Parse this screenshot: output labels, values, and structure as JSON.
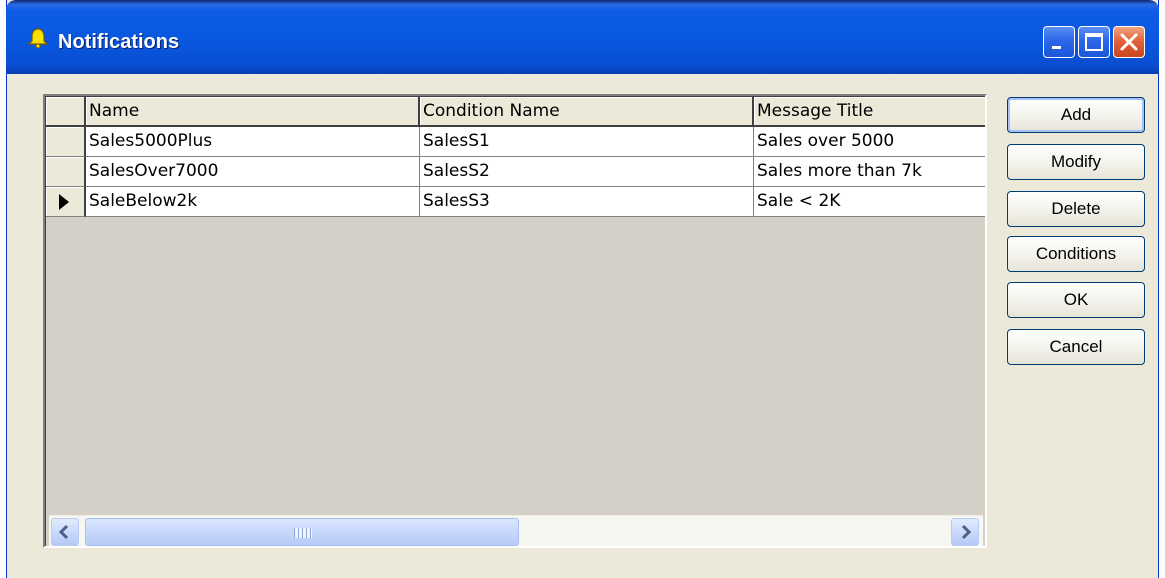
{
  "window": {
    "title": "Notifications",
    "icon": "bell-icon",
    "controls": [
      "minimize-icon",
      "maximize-icon",
      "close-icon"
    ]
  },
  "grid": {
    "columns": [
      "Name",
      "Condition Name",
      "Message Title"
    ],
    "rows": [
      {
        "name": "Sales5000Plus",
        "condition": "SalesS1",
        "title": "Sales over 5000",
        "current": false
      },
      {
        "name": "SalesOver7000",
        "condition": "SalesS2",
        "title": "Sales more than 7k",
        "current": false
      },
      {
        "name": "SaleBelow2k",
        "condition": "SalesS3",
        "title": "Sale < 2K",
        "current": true
      }
    ]
  },
  "buttons": {
    "add": "Add",
    "modify": "Modify",
    "delete": "Delete",
    "conditions": "Conditions",
    "ok": "OK",
    "cancel": "Cancel"
  },
  "colors": {
    "titlebar": "#0856de",
    "face": "#ece9d8",
    "close": "#e2643c"
  }
}
